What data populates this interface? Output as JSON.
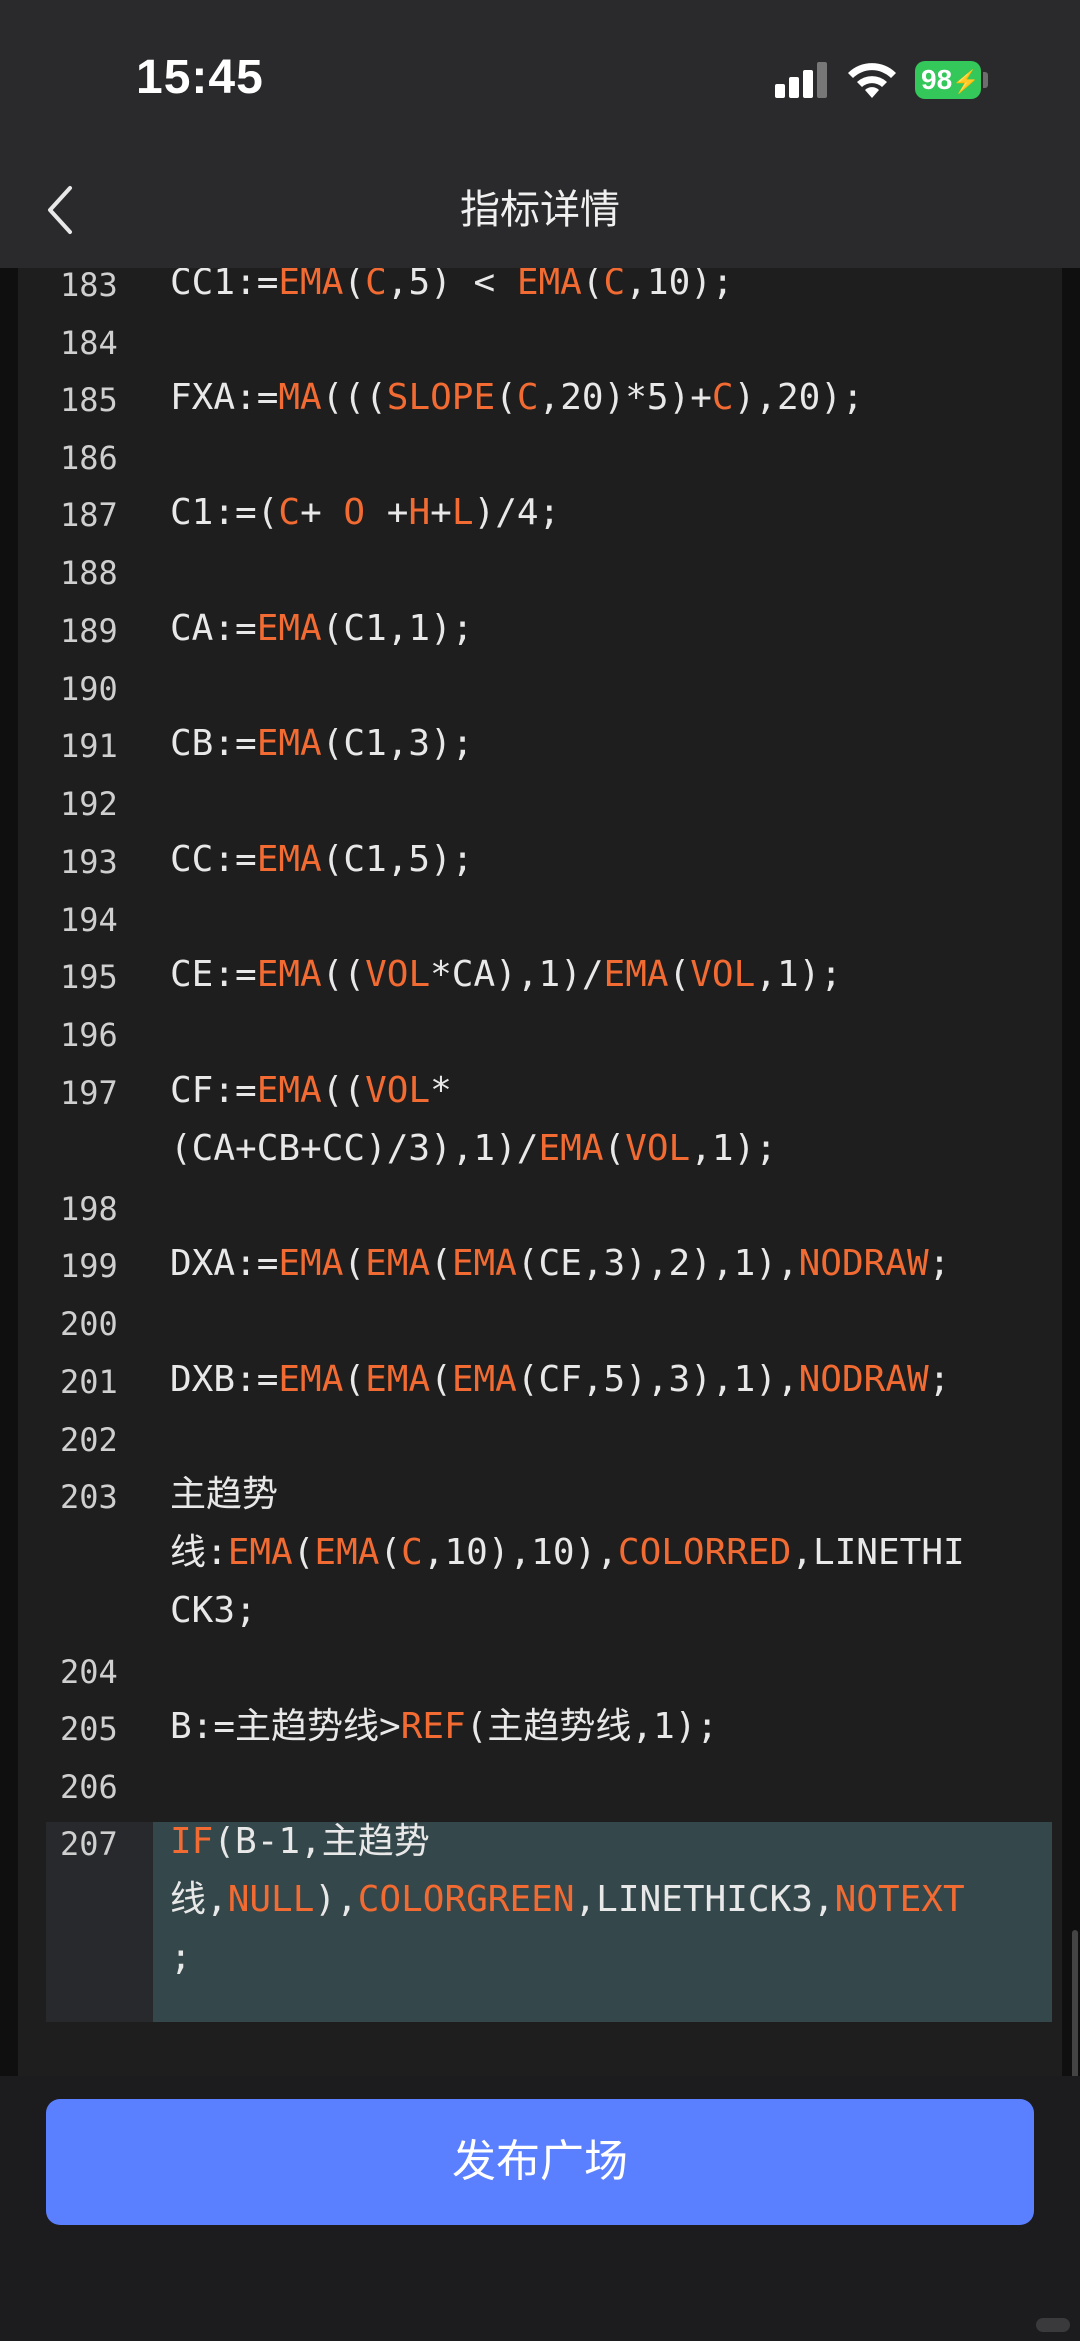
{
  "status_bar": {
    "time": "15:45",
    "battery": "98"
  },
  "header": {
    "title": "指标详情"
  },
  "editor": {
    "lines": [
      {
        "n": "183",
        "tokens": [
          [
            "CC1:=",
            ""
          ],
          [
            "EMA",
            "f"
          ],
          [
            "(",
            ""
          ],
          [
            "C",
            "f"
          ],
          [
            ",5) < ",
            ""
          ],
          [
            "EMA",
            "f"
          ],
          [
            "(",
            ""
          ],
          [
            "C",
            "f"
          ],
          [
            ",10);",
            ""
          ]
        ]
      },
      {
        "n": "184",
        "tokens": []
      },
      {
        "n": "185",
        "tokens": [
          [
            "FXA:=",
            ""
          ],
          [
            "MA",
            "f"
          ],
          [
            "(((",
            ""
          ],
          [
            "SLOPE",
            "f"
          ],
          [
            "(",
            ""
          ],
          [
            "C",
            "f"
          ],
          [
            ",20)*5)+",
            ""
          ],
          [
            "C",
            "f"
          ],
          [
            "),20);",
            ""
          ]
        ]
      },
      {
        "n": "186",
        "tokens": []
      },
      {
        "n": "187",
        "tokens": [
          [
            "C1:=(",
            ""
          ],
          [
            "C",
            "f"
          ],
          [
            "+ ",
            ""
          ],
          [
            "O",
            "f"
          ],
          [
            " +",
            ""
          ],
          [
            "H",
            "f"
          ],
          [
            "+",
            ""
          ],
          [
            "L",
            "f"
          ],
          [
            ")/4;",
            ""
          ]
        ]
      },
      {
        "n": "188",
        "tokens": []
      },
      {
        "n": "189",
        "tokens": [
          [
            "CA:=",
            ""
          ],
          [
            "EMA",
            "f"
          ],
          [
            "(C1,1);",
            ""
          ]
        ]
      },
      {
        "n": "190",
        "tokens": []
      },
      {
        "n": "191",
        "tokens": [
          [
            "CB:=",
            ""
          ],
          [
            "EMA",
            "f"
          ],
          [
            "(C1,3);",
            ""
          ]
        ]
      },
      {
        "n": "192",
        "tokens": []
      },
      {
        "n": "193",
        "tokens": [
          [
            "CC:=",
            ""
          ],
          [
            "EMA",
            "f"
          ],
          [
            "(C1,5);",
            ""
          ]
        ]
      },
      {
        "n": "194",
        "tokens": []
      },
      {
        "n": "195",
        "tokens": [
          [
            "CE:=",
            ""
          ],
          [
            "EMA",
            "f"
          ],
          [
            "((",
            ""
          ],
          [
            "VOL",
            "f"
          ],
          [
            "*CA),1)/",
            ""
          ],
          [
            "EMA",
            "f"
          ],
          [
            "(",
            ""
          ],
          [
            "VOL",
            "f"
          ],
          [
            ",1);",
            ""
          ]
        ]
      },
      {
        "n": "196",
        "tokens": []
      },
      {
        "n": "197",
        "tokens": [
          [
            "CF:=",
            ""
          ],
          [
            "EMA",
            "f"
          ],
          [
            "((",
            ""
          ],
          [
            "VOL",
            "f"
          ],
          [
            "*\n(CA+CB+CC)/3),1)/",
            ""
          ],
          [
            "EMA",
            "f"
          ],
          [
            "(",
            ""
          ],
          [
            "VOL",
            "f"
          ],
          [
            ",1);",
            ""
          ]
        ]
      },
      {
        "n": "198",
        "tokens": []
      },
      {
        "n": "199",
        "tokens": [
          [
            "DXA:=",
            ""
          ],
          [
            "EMA",
            "f"
          ],
          [
            "(",
            ""
          ],
          [
            "EMA",
            "f"
          ],
          [
            "(",
            ""
          ],
          [
            "EMA",
            "f"
          ],
          [
            "(CE,3),2),1),",
            ""
          ],
          [
            "NODRAW",
            "f"
          ],
          [
            ";",
            ""
          ]
        ]
      },
      {
        "n": "200",
        "tokens": []
      },
      {
        "n": "201",
        "tokens": [
          [
            "DXB:=",
            ""
          ],
          [
            "EMA",
            "f"
          ],
          [
            "(",
            ""
          ],
          [
            "EMA",
            "f"
          ],
          [
            "(",
            ""
          ],
          [
            "EMA",
            "f"
          ],
          [
            "(CF,5),3),1),",
            ""
          ],
          [
            "NODRAW",
            "f"
          ],
          [
            ";",
            ""
          ]
        ]
      },
      {
        "n": "202",
        "tokens": []
      },
      {
        "n": "203",
        "tokens": [
          [
            "主趋势\n线:",
            ""
          ],
          [
            "EMA",
            "f"
          ],
          [
            "(",
            ""
          ],
          [
            "EMA",
            "f"
          ],
          [
            "(",
            ""
          ],
          [
            "C",
            "f"
          ],
          [
            ",10),10),",
            ""
          ],
          [
            "COLORRED",
            "f"
          ],
          [
            ",LINETHI\nCK3;",
            ""
          ]
        ]
      },
      {
        "n": "204",
        "tokens": []
      },
      {
        "n": "205",
        "tokens": [
          [
            "B:=主趋势线>",
            ""
          ],
          [
            "REF",
            "f"
          ],
          [
            "(主趋势线,1);",
            ""
          ]
        ]
      },
      {
        "n": "206",
        "tokens": []
      },
      {
        "n": "207",
        "tokens": [
          [
            "IF",
            "f"
          ],
          [
            "(B-1,主趋势\n线,",
            ""
          ],
          [
            "NULL",
            "f"
          ],
          [
            "),",
            ""
          ],
          [
            "COLORGREEN",
            "f"
          ],
          [
            ",LINETHICK3,",
            ""
          ],
          [
            "NOTEXT",
            "f"
          ],
          [
            "\n;",
            ""
          ]
        ]
      }
    ]
  },
  "footer": {
    "publish_label": "发布广场"
  },
  "colors": {
    "keyword": "#f26b32",
    "button": "#5a7fff",
    "highlight": "#34474a"
  }
}
